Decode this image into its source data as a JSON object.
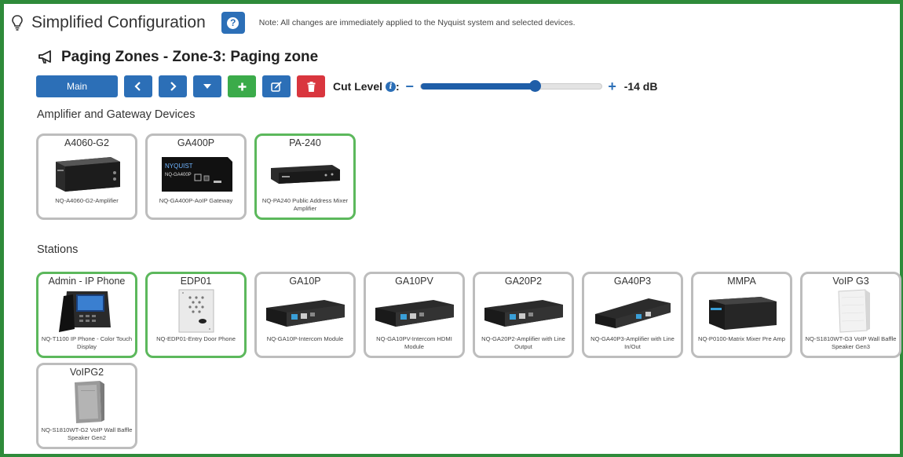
{
  "header": {
    "title": "Simplified Configuration",
    "help_label": "?",
    "note": "Note: All changes are immediately applied to the Nyquist system and selected devices."
  },
  "zone": {
    "title": "Paging Zones - Zone-3:  Paging zone"
  },
  "toolbar": {
    "main_label": "Main",
    "cut_level_label": "Cut Level",
    "info_label": "i",
    "minus": "−",
    "plus": "+",
    "cut_level_value": "-14 dB",
    "cut_level_fraction": 0.63
  },
  "amplifiers": {
    "heading": "Amplifier and Gateway Devices",
    "items": [
      {
        "title": "A4060-G2",
        "desc": "NQ-A4060-G2-Amplifier",
        "selected": false,
        "icon": "amplifier-box-icon"
      },
      {
        "title": "GA400P",
        "desc": "NQ-GA400P-AoIP Gateway",
        "selected": false,
        "icon": "gateway-box-icon"
      },
      {
        "title": "PA-240",
        "desc": "NQ-PA240 Public Address Mixer Amplifier",
        "selected": true,
        "icon": "rack-amplifier-icon"
      }
    ]
  },
  "stations": {
    "heading": "Stations",
    "items": [
      {
        "title": "Admin - IP Phone",
        "desc": "NQ-T1100 IP Phone - Color Touch Display",
        "selected": true,
        "icon": "ip-phone-icon"
      },
      {
        "title": "EDP01",
        "desc": "NQ-EDP01-Entry Door Phone",
        "selected": true,
        "icon": "door-phone-icon"
      },
      {
        "title": "GA10P",
        "desc": "NQ-GA10P-Intercom Module",
        "selected": false,
        "icon": "intercom-module-icon"
      },
      {
        "title": "GA10PV",
        "desc": "NQ-GA10PV-Intercom HDMI Module",
        "selected": false,
        "icon": "intercom-module-icon"
      },
      {
        "title": "GA20P2",
        "desc": "NQ-GA20P2-Amplifier with Line Output",
        "selected": false,
        "icon": "intercom-module-icon"
      },
      {
        "title": "GA40P3",
        "desc": "NQ-GA40P3-Amplifier with Line In/Out",
        "selected": false,
        "icon": "amp-module-icon"
      },
      {
        "title": "MMPA",
        "desc": "NQ-P0100-Matrix Mixer Pre Amp",
        "selected": false,
        "icon": "mixer-box-icon"
      },
      {
        "title": "VoIP G3",
        "desc": "NQ-S1810WT-G3 VoIP Wall Baffle Speaker Gen3",
        "selected": false,
        "icon": "wall-speaker-icon"
      },
      {
        "title": "VoIPG2",
        "desc": "NQ-S1810WT-G2 VoIP Wall Baffle Speaker Gen2",
        "selected": false,
        "icon": "wall-speaker-grey-icon"
      }
    ]
  },
  "colors": {
    "frame": "#2e8b3a",
    "primary": "#2c6fb7",
    "success": "#3bab4a",
    "danger": "#d9363e",
    "selected_border": "#5cb85c",
    "card_border": "#bdbdbd"
  }
}
